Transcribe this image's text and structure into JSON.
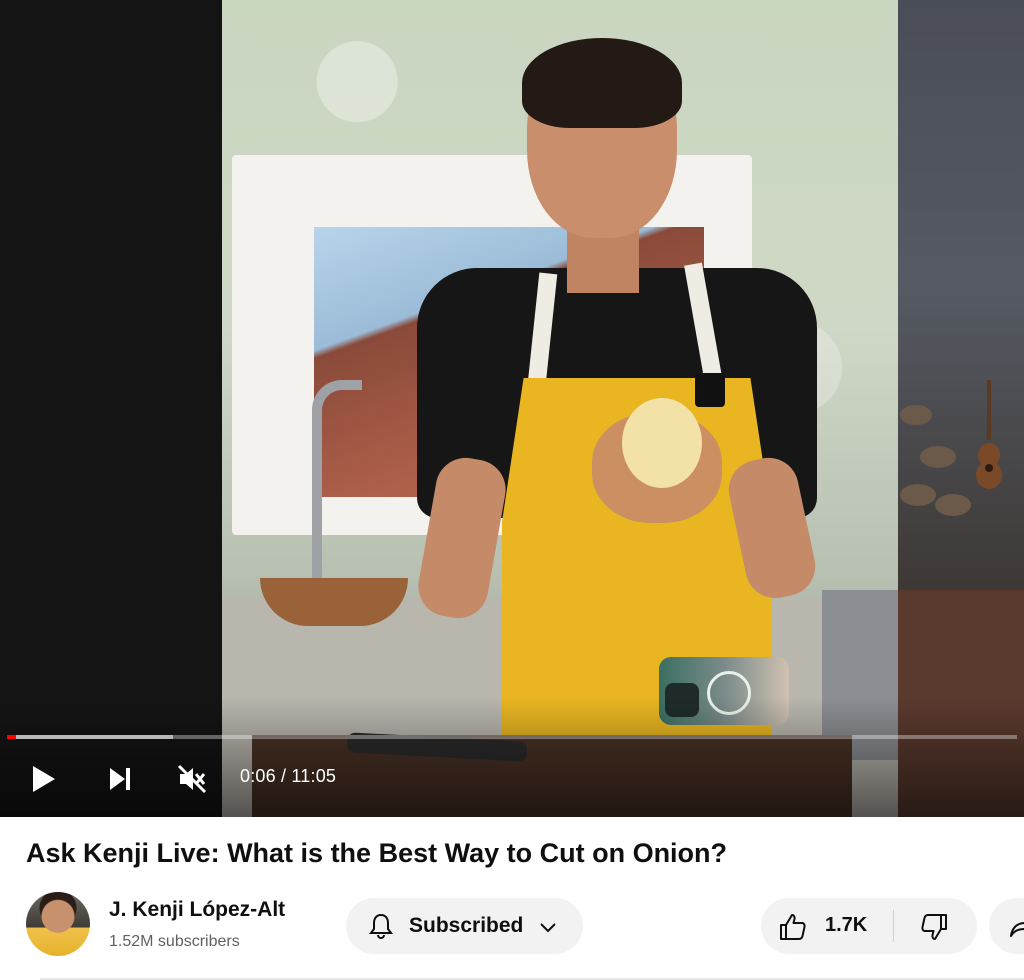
{
  "player": {
    "current_time": "0:06",
    "duration": "11:05",
    "time_display": "0:06 / 11:05",
    "played_fraction": 0.009,
    "buffered_fraction": 0.164,
    "muted": true,
    "icons": {
      "play": "play-icon",
      "next": "next-icon",
      "mute": "muted-volume-icon"
    }
  },
  "video": {
    "title": "Ask Kenji Live: What is the Best Way to Cut on Onion?"
  },
  "channel": {
    "name": "J. Kenji López-Alt",
    "subscribers": "1.52M subscribers",
    "avatar_icon": "channel-avatar"
  },
  "actions": {
    "subscribe_label": "Subscribed",
    "like_count": "1.7K",
    "icons": {
      "bell": "bell-icon",
      "chevron": "chevron-down-icon",
      "like": "thumbs-up-icon",
      "dislike": "thumbs-down-icon",
      "share": "share-icon"
    }
  },
  "colors": {
    "progress_played": "#ff0000",
    "button_bg": "#f2f2f2",
    "text_primary": "#0f0f0f",
    "text_secondary": "#606060"
  }
}
